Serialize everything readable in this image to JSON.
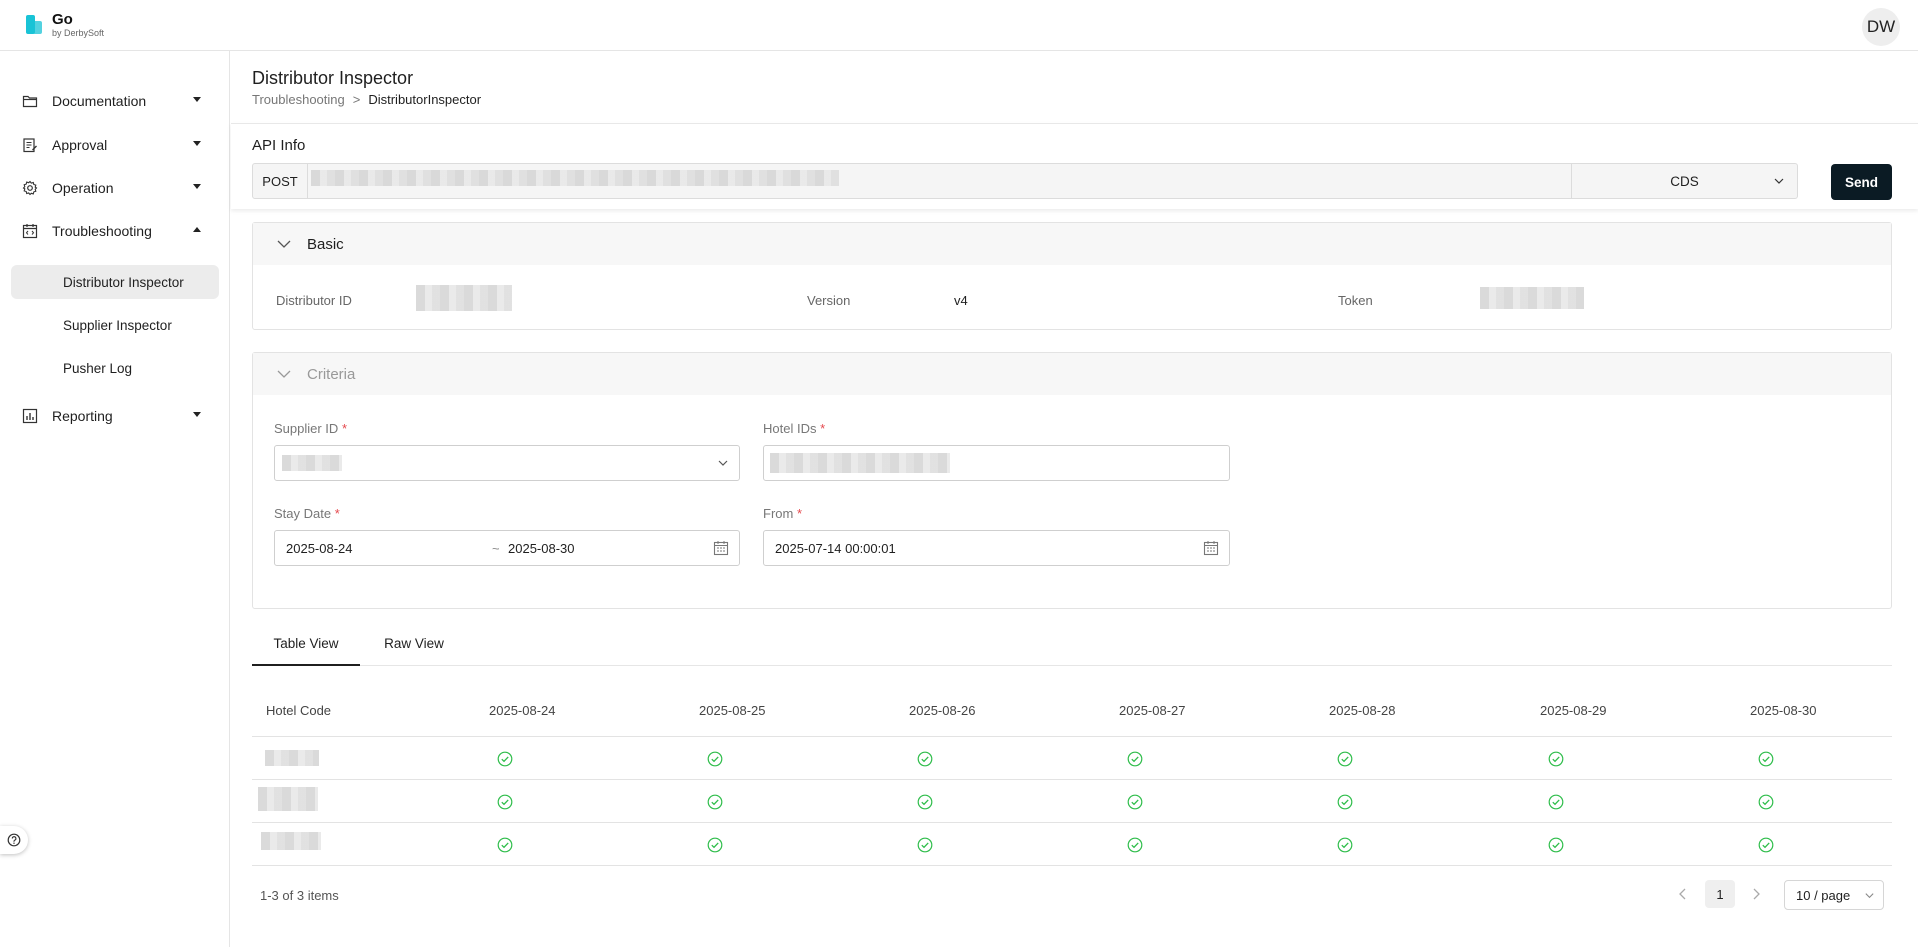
{
  "app": {
    "logo_title": "Go",
    "logo_subtitle": "by DerbySoft",
    "avatar_initials": "DW"
  },
  "sidebar": {
    "items": [
      {
        "label": "Documentation",
        "icon": "folder-icon"
      },
      {
        "label": "Approval",
        "icon": "clipboard-edit-icon"
      },
      {
        "label": "Operation",
        "icon": "gear-icon"
      },
      {
        "label": "Troubleshooting",
        "icon": "calendar-code-icon"
      },
      {
        "label": "Reporting",
        "icon": "bar-chart-icon"
      }
    ],
    "sub_items": [
      "Distributor Inspector",
      "Supplier Inspector",
      "Pusher Log"
    ],
    "active_sub_item": "Distributor Inspector"
  },
  "page": {
    "title": "Distributor Inspector",
    "breadcrumb": [
      "Troubleshooting",
      "DistributorInspector"
    ],
    "breadcrumb_sep": ">"
  },
  "api": {
    "title": "API Info",
    "method": "POST",
    "environment": "CDS",
    "send_label": "Send"
  },
  "basic": {
    "title": "Basic",
    "distributor_id_label": "Distributor ID",
    "version_label": "Version",
    "version_value": "v4",
    "token_label": "Token"
  },
  "criteria": {
    "title": "Criteria",
    "supplier_id_label": "Supplier ID",
    "hotel_ids_label": "Hotel IDs",
    "stay_date_label": "Stay Date",
    "stay_date_start": "2025-08-24",
    "stay_date_sep": "~",
    "stay_date_end": "2025-08-30",
    "from_label": "From",
    "from_value": "2025-07-14 00:00:01",
    "required_mark": "*"
  },
  "tabs": [
    "Table View",
    "Raw View"
  ],
  "table": {
    "columns": [
      "Hotel Code",
      "2025-08-24",
      "2025-08-25",
      "2025-08-26",
      "2025-08-27",
      "2025-08-28",
      "2025-08-29",
      "2025-08-30"
    ],
    "row_count": 3
  },
  "pagination": {
    "summary": "1-3 of 3 items",
    "current_page": "1",
    "page_size": "10 / page"
  },
  "colors": {
    "accent": "#0b1b24",
    "success": "#2ebd4a",
    "logo": "#19c3d6",
    "required": "#e5484d"
  }
}
